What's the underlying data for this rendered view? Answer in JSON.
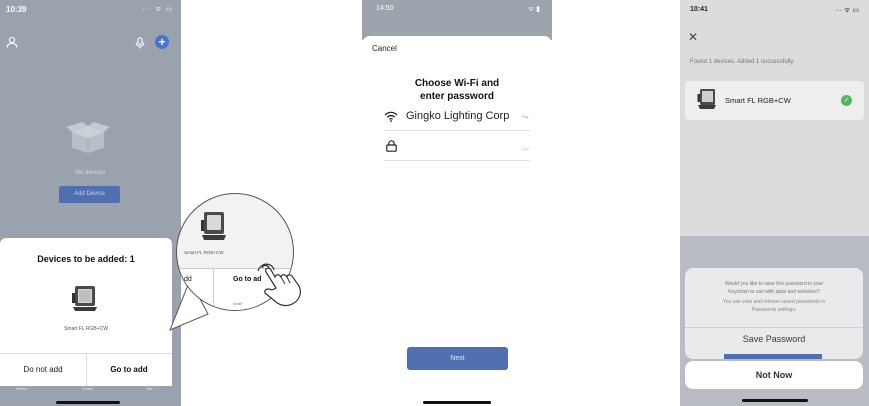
{
  "screen1": {
    "status_time": "10:39",
    "status_icons": "··· ᯤ ▭",
    "empty_text": "No devices",
    "add_device_label": "Add Device",
    "sheet_title": "Devices to be added: 1",
    "device_name": "Smart FL RGB+CW",
    "do_not_add_label": "Do not add",
    "go_to_add_label": "Go to add",
    "tabs": [
      "Home",
      "Smart",
      "Me"
    ],
    "accent_color": "#4a74cf"
  },
  "callout": {
    "device_name": "Smart FL RGB+CW",
    "do_not_add_partial": "dd",
    "go_to_add_partial": "Go to ad",
    "tab_partial": "Smart"
  },
  "screen2": {
    "status_time": "14:50",
    "status_icons": "ᯤ ▮",
    "cancel_label": "Cancel",
    "title_line1": "Choose Wi-Fi and",
    "title_line2": "enter password",
    "ssid": "Gingko Lighting Corp",
    "swap_icon": "⇋",
    "eye_icon": "◡",
    "next_label": "Next",
    "button_color": "#4f6fb0"
  },
  "screen3": {
    "status_time": "10:41",
    "status_icons": "··· ᯤ ▭",
    "close_icon": "✕",
    "found_text": "Found 1 devices. Added 1 successfully.",
    "device_name": "Smart FL RGB+CW",
    "check_icon": "✓",
    "alert_line1": "Would you like to save this password in your",
    "alert_line2": "Keychain to use with apps and websites?",
    "alert_line3": "You can view and remove saved passwords in",
    "alert_line4": "Passwords settings.",
    "save_label": "Save Password",
    "not_now_label": "Not Now",
    "success_color": "#58b55f"
  }
}
